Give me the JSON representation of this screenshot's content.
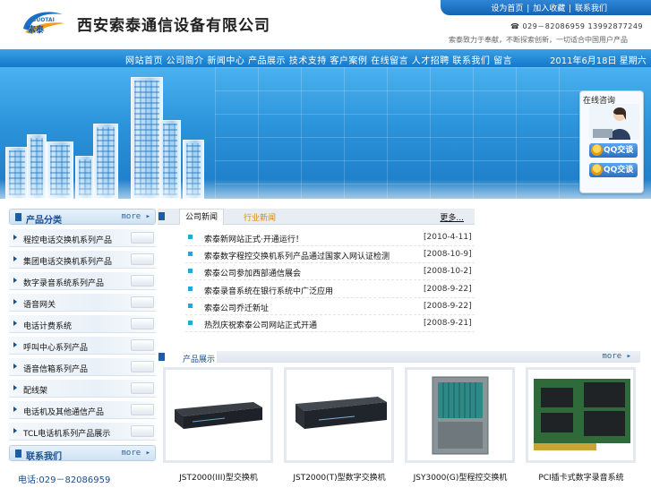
{
  "header": {
    "logo_text": "索泰",
    "logo_sub": "SUOTAI",
    "company_name": "西安索泰通信设备有限公司",
    "top_links": [
      "设为首页",
      "加入收藏",
      "联系我们"
    ],
    "phone_line": "☎ 029－82086959  13992877249",
    "slogan": "索泰致力于奉献，不断探索创新，一切适合中国用户产品"
  },
  "nav": {
    "items_text": "网站首页 公司简介 新闻中心 产品展示 技术支持 客户案例 在线留言 人才招聘 联系我们 留言",
    "date": "2011年6月18日  星期六"
  },
  "consult": {
    "title": "在线咨询",
    "qq_buttons": [
      "QQ交谈",
      "QQ交谈"
    ]
  },
  "sidebar": {
    "category_title": "产品分类",
    "more_label": "more ▸",
    "items": [
      "程控电话交换机系列产品",
      "集团电话交换机系列产品",
      "数字录音系统系列产品",
      "语音网关",
      "电话计费系统",
      "呼叫中心系列产品",
      "语音信箱系列产品",
      "配线架",
      "电话机及其他通信产品",
      "TCL电话机系列产品展示"
    ],
    "contact_title": "联系我们",
    "contact_more": "more ▸",
    "contact_phone": "电话:029－82086959"
  },
  "news": {
    "tab_active": "公司新闻",
    "tab_inactive": "行业新闻",
    "more": "更多...",
    "items": [
      {
        "title": "索泰新网站正式·开通运行！",
        "date": "[2010-4-11]"
      },
      {
        "title": "索泰数字程控交换机系列产品通过国家入网认证检测",
        "date": "[2008-10-9]"
      },
      {
        "title": "索泰公司参加西部通信展会",
        "date": "[2008-10-2]"
      },
      {
        "title": "索泰录音系统在银行系统中广泛应用",
        "date": "[2008-9-22]"
      },
      {
        "title": "索泰公司乔迁新址",
        "date": "[2008-9-22]"
      },
      {
        "title": "热烈庆祝索泰公司网站正式开通",
        "date": "[2008-9-21]"
      }
    ]
  },
  "products": {
    "title": "产品展示",
    "more": "more ▸",
    "items": [
      {
        "name": "JST2000(III)型交换机"
      },
      {
        "name": "JST2000(T)型数字交换机"
      },
      {
        "name": "JSY3000(G)型程控交换机"
      },
      {
        "name": "PCI插卡式数字录音系统"
      }
    ]
  },
  "colors": {
    "brand_blue": "#1378c8",
    "accent_orange": "#d48a00",
    "bullet_cyan": "#2aa3d9"
  }
}
